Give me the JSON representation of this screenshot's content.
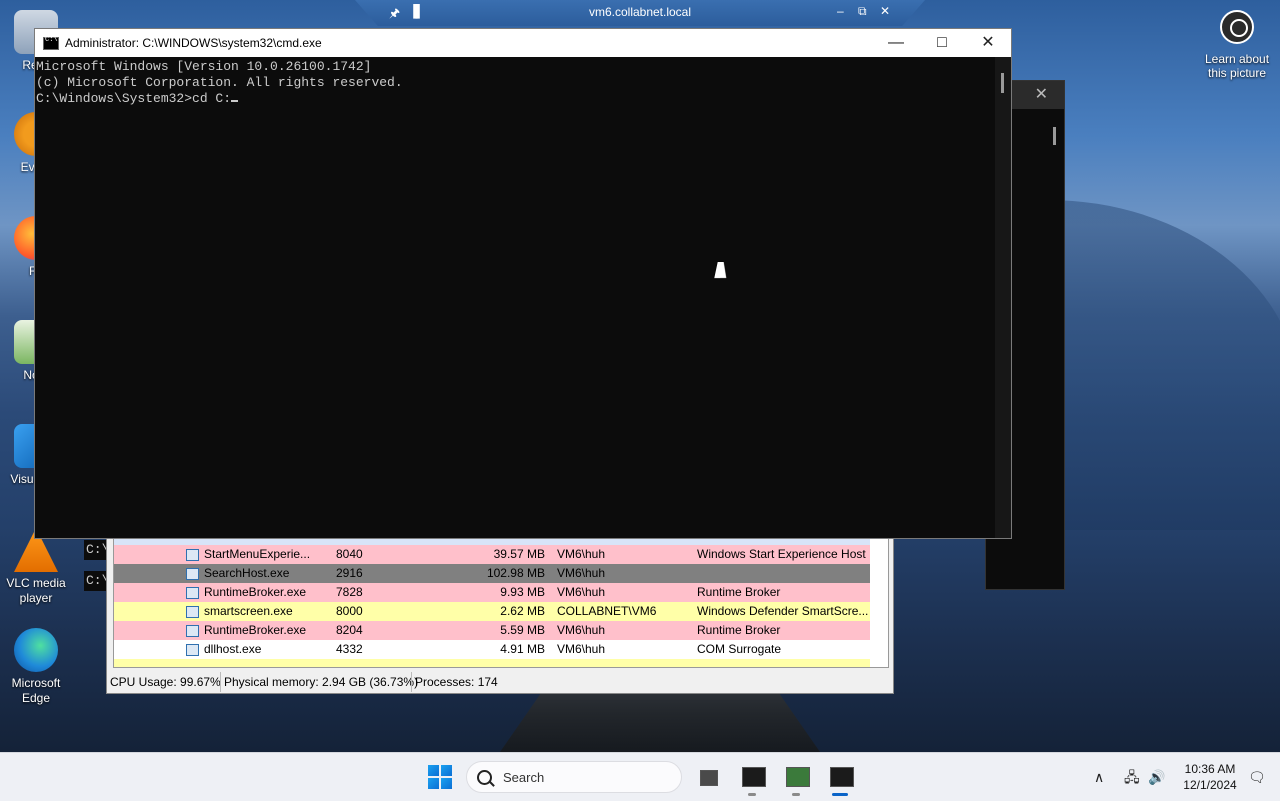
{
  "remote_session": {
    "title": "vm6.collabnet.local",
    "pin_icon": "pin-icon",
    "signal_icon": "signal-icon",
    "minimize": "–",
    "restore": "⧉",
    "close": "✕"
  },
  "desktop_icons": [
    {
      "label": "Recy",
      "icon": "recycle-bin-icon"
    },
    {
      "label": "Every",
      "icon": "everything-icon"
    },
    {
      "label": "Fir",
      "icon": "firefox-icon"
    },
    {
      "label": "Note",
      "icon": "notepad-icon"
    },
    {
      "label": "Visual Co",
      "icon": "vscode-icon"
    },
    {
      "label": "VLC media player",
      "icon": "vlc-icon"
    },
    {
      "label": "Microsoft Edge",
      "icon": "edge-icon"
    }
  ],
  "learn_about": {
    "label": "Learn about this picture"
  },
  "cmd": {
    "title": "Administrator: C:\\WINDOWS\\system32\\cmd.exe",
    "lines": [
      "Microsoft Windows [Version 10.0.26100.1742]",
      "(c) Microsoft Corporation. All rights reserved.",
      "",
      "C:\\Windows\\System32>cd C:"
    ],
    "minimize": "—",
    "maximize": "□",
    "close": "✕"
  },
  "back_cmd": {
    "close": "✕"
  },
  "console_peek": [
    "C:\\",
    "C:\\"
  ],
  "process_list": {
    "rows": [
      {
        "name": "StartMenuExperie...",
        "pid": "8040",
        "mem": "39.57 MB",
        "user": "VM6\\huh",
        "desc": "Windows Start Experience Host",
        "color": "#ffc0cb"
      },
      {
        "name": "SearchHost.exe",
        "pid": "2916",
        "mem": "102.98 MB",
        "user": "VM6\\huh",
        "desc": "",
        "color": "#808080"
      },
      {
        "name": "RuntimeBroker.exe",
        "pid": "7828",
        "mem": "9.93 MB",
        "user": "VM6\\huh",
        "desc": "Runtime Broker",
        "color": "#ffc0cb"
      },
      {
        "name": "smartscreen.exe",
        "pid": "8000",
        "mem": "2.62 MB",
        "user": "COLLABNET\\VM6",
        "desc": "Windows Defender SmartScre...",
        "color": "#ffffa8"
      },
      {
        "name": "RuntimeBroker.exe",
        "pid": "8204",
        "mem": "5.59 MB",
        "user": "VM6\\huh",
        "desc": "Runtime Broker",
        "color": "#ffc0cb"
      },
      {
        "name": "dllhost.exe",
        "pid": "4332",
        "mem": "4.91 MB",
        "user": "VM6\\huh",
        "desc": "COM Surrogate",
        "color": "#ffffff"
      }
    ],
    "status": {
      "cpu": "CPU Usage: 99.67%",
      "memory": "Physical memory: 2.94 GB (36.73%)",
      "processes": "Processes: 174"
    }
  },
  "taskbar": {
    "search_placeholder": "Search",
    "apps": [
      {
        "icon": "task-view-icon"
      },
      {
        "icon": "cmd-icon"
      },
      {
        "icon": "process-hacker-icon"
      },
      {
        "icon": "cmd-icon-active"
      }
    ],
    "tray": {
      "chevron": "∧",
      "time": "10:36 AM",
      "date": "12/1/2024"
    }
  }
}
